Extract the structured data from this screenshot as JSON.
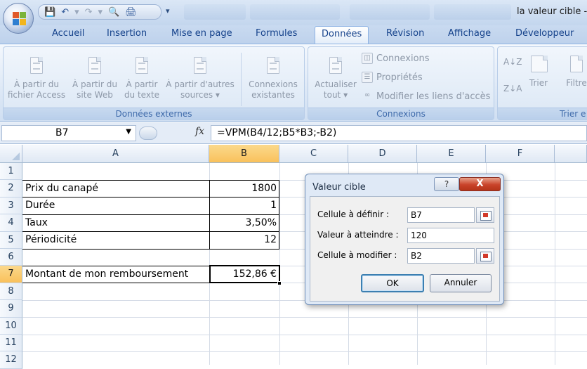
{
  "window": {
    "title": "la valeur cible -"
  },
  "ribbon_tabs": [
    "Accueil",
    "Insertion",
    "Mise en page",
    "Formules",
    "Données",
    "Révision",
    "Affichage",
    "Développeur"
  ],
  "active_tab": "Données",
  "groups": {
    "donnees_externes": {
      "label": "Données externes",
      "buttons": [
        {
          "line1": "À partir du",
          "line2": "fichier Access"
        },
        {
          "line1": "À partir du",
          "line2": "site Web"
        },
        {
          "line1": "À partir",
          "line2": "du texte"
        },
        {
          "line1": "À partir d'autres",
          "line2": "sources ▾"
        },
        {
          "line1": "Connexions",
          "line2": "existantes"
        }
      ]
    },
    "connexions": {
      "label": "Connexions",
      "actualiser": {
        "line1": "Actualiser",
        "line2": "tout ▾"
      },
      "items": [
        "Connexions",
        "Propriétés",
        "Modifier les liens d'accès"
      ]
    },
    "trier": {
      "label": "Trier e",
      "trier_label": "Trier",
      "filtrer_label": "Filtre"
    }
  },
  "formula_bar": {
    "name_box": "B7",
    "fx": "fx",
    "formula": "=VPM(B4/12;B5*B3;-B2)"
  },
  "sheet": {
    "columns": [
      "A",
      "B",
      "C",
      "D",
      "E",
      "F"
    ],
    "rows": [
      "1",
      "2",
      "3",
      "4",
      "5",
      "6",
      "7",
      "8",
      "9",
      "10",
      "11",
      "12"
    ],
    "cells": {
      "A2": "Prix du canapé",
      "B2": "1800",
      "A3": "Durée",
      "B3": "1",
      "A4": "Taux",
      "B4": "3,50%",
      "A5": "Périodicité",
      "B5": "12",
      "A7": "Montant de mon remboursement",
      "B7": "152,86 €"
    },
    "selected_column": "B",
    "selected_row": "7"
  },
  "dialog": {
    "title": "Valeur cible",
    "help": "?",
    "close": "X",
    "fields": [
      {
        "label": "Cellule à définir :",
        "value": "B7"
      },
      {
        "label": "Valeur à atteindre :",
        "value": "120"
      },
      {
        "label": "Cellule à modifier :",
        "value": "B2"
      }
    ],
    "ok": "OK",
    "cancel": "Annuler"
  },
  "colors": {
    "ribbon_text": "#15428b",
    "selection_header": "#f9c15b",
    "close_red": "#c9432a"
  }
}
